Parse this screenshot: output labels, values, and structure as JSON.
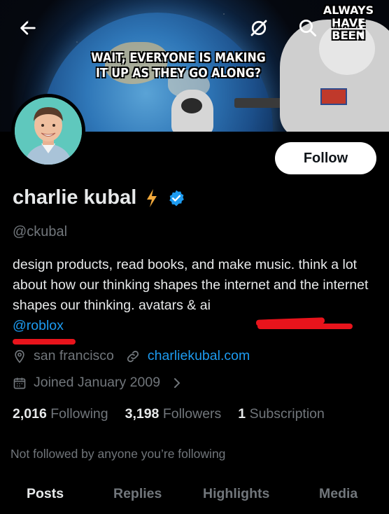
{
  "banner": {
    "meme_text_line1": "WAIT, EVERYONE IS MAKING",
    "meme_text_line2": "IT UP AS THEY GO ALONG?",
    "watermark_line1": "ALWAYS",
    "watermark_line2": "HAVE BEEN"
  },
  "header": {
    "back_icon": "arrow-left-icon",
    "grok_icon": "grok-slash-icon",
    "search_icon": "search-icon"
  },
  "profile": {
    "display_name": "charlie kubal",
    "handle": "@ckubal",
    "bio_text": "design products, read books, and make music. think a lot about how our thinking shapes the internet and the internet shapes our thinking. avatars & ai",
    "bio_mention": "@roblox",
    "location": "san francisco",
    "website": "charliekubal.com",
    "joined": "Joined January 2009",
    "follow_label": "Follow"
  },
  "stats": {
    "following_count": "2,016",
    "following_label": "Following",
    "followers_count": "3,198",
    "followers_label": "Followers",
    "subscription_count": "1",
    "subscription_label": "Subscription"
  },
  "social_context": "Not followed by anyone you’re following",
  "tabs": [
    "Posts",
    "Replies",
    "Highlights",
    "Media"
  ],
  "colors": {
    "background": "#000000",
    "text_primary": "#e7e9ea",
    "text_secondary": "#71767b",
    "link": "#1d9bf0",
    "verified": "#1d9bf0",
    "lightning": "#f2a93b",
    "annotation_red": "#e8141c"
  }
}
